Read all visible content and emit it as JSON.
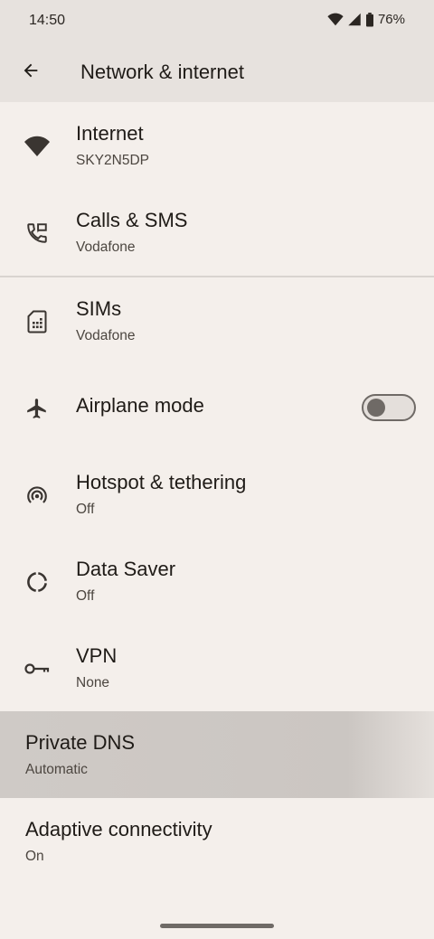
{
  "status_bar": {
    "time": "14:50",
    "battery": "76%"
  },
  "header": {
    "title": "Network & internet"
  },
  "items": [
    {
      "id": "internet",
      "title": "Internet",
      "subtitle": "SKY2N5DP",
      "icon": "wifi-icon"
    },
    {
      "id": "calls-sms",
      "title": "Calls & SMS",
      "subtitle": "Vodafone",
      "icon": "phone-message-icon"
    },
    {
      "id": "sims",
      "title": "SIMs",
      "subtitle": "Vodafone",
      "icon": "sim-card-icon"
    },
    {
      "id": "airplane-mode",
      "title": "Airplane mode",
      "icon": "airplane-icon",
      "toggle_on": false
    },
    {
      "id": "hotspot",
      "title": "Hotspot & tethering",
      "subtitle": "Off",
      "icon": "hotspot-icon"
    },
    {
      "id": "data-saver",
      "title": "Data Saver",
      "subtitle": "Off",
      "icon": "data-saver-icon"
    },
    {
      "id": "vpn",
      "title": "VPN",
      "subtitle": "None",
      "icon": "key-icon"
    },
    {
      "id": "private-dns",
      "title": "Private DNS",
      "subtitle": "Automatic"
    },
    {
      "id": "adaptive-connectivity",
      "title": "Adaptive connectivity",
      "subtitle": "On"
    }
  ],
  "colors": {
    "background": "#f4efeb",
    "app_bar": "#e7e2de",
    "highlight": "#cbc6c2",
    "icon": "#3a3531"
  }
}
